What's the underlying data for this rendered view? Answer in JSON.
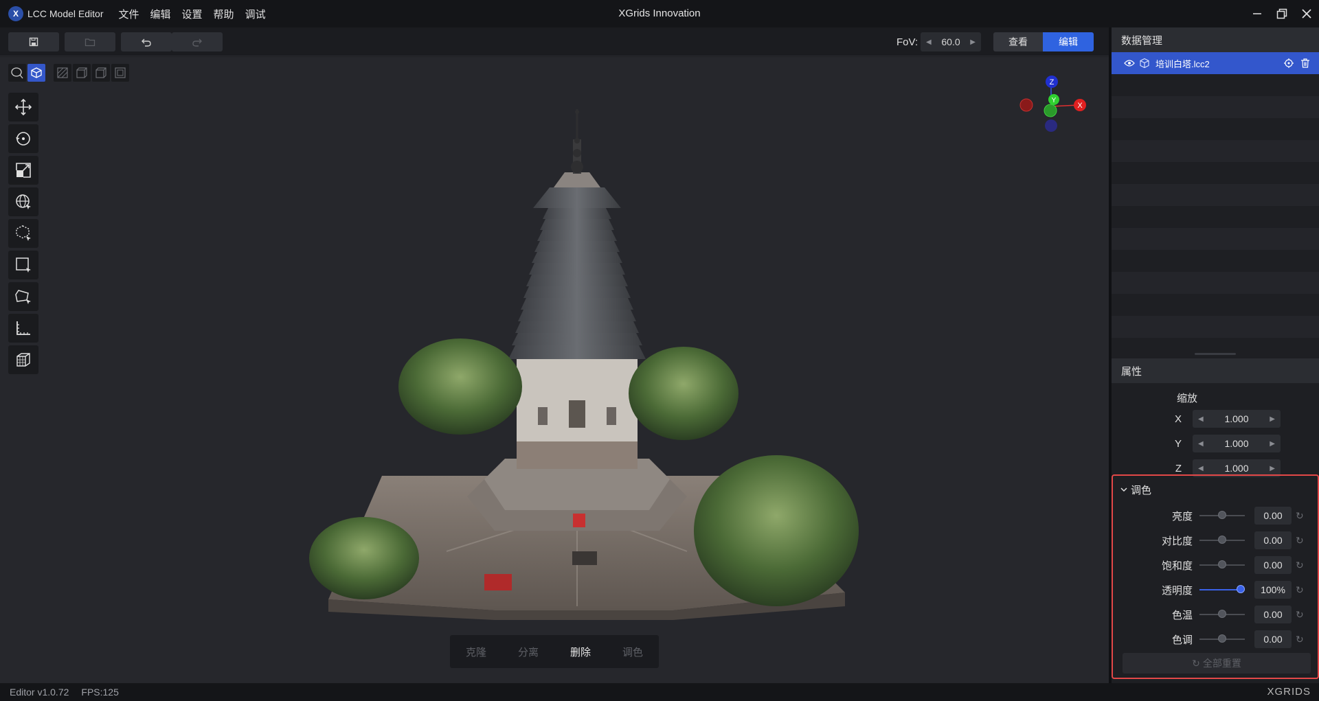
{
  "app": {
    "logo_mark": "X",
    "name": "LCC Model Editor",
    "window_title": "XGrids Innovation"
  },
  "menu": [
    "文件",
    "编辑",
    "设置",
    "帮助",
    "调试"
  ],
  "toolbar": {
    "fov_label": "FoV:",
    "fov_value": "60.0",
    "view_mode": "查看",
    "edit_mode": "编辑"
  },
  "gizmo": {
    "z": "Z",
    "y": "Y",
    "x": "X"
  },
  "bottom_actions": [
    "克隆",
    "分离",
    "删除",
    "调色"
  ],
  "data_panel": {
    "title": "数据管理",
    "file": "培训白塔.lcc2"
  },
  "props_panel": {
    "title": "属性",
    "scale_title": "缩放",
    "scale": [
      {
        "axis": "X",
        "value": "1.000"
      },
      {
        "axis": "Y",
        "value": "1.000"
      },
      {
        "axis": "Z",
        "value": "1.000"
      }
    ]
  },
  "color_panel": {
    "title": "调色",
    "rows": [
      {
        "label": "亮度",
        "value": "0.00",
        "level": 0.5
      },
      {
        "label": "对比度",
        "value": "0.00",
        "level": 0.5
      },
      {
        "label": "饱和度",
        "value": "0.00",
        "level": 0.5
      },
      {
        "label": "透明度",
        "value": "100%",
        "level": 1.0
      },
      {
        "label": "色温",
        "value": "0.00",
        "level": 0.5
      },
      {
        "label": "色调",
        "value": "0.00",
        "level": 0.5
      }
    ],
    "reset_all": "全部重置"
  },
  "status": {
    "version": "Editor v1.0.72",
    "fps": "FPS:125",
    "brand": "XGRIDS"
  },
  "colors": {
    "accent": "#2f63e0",
    "highlight_border": "#e44848"
  }
}
